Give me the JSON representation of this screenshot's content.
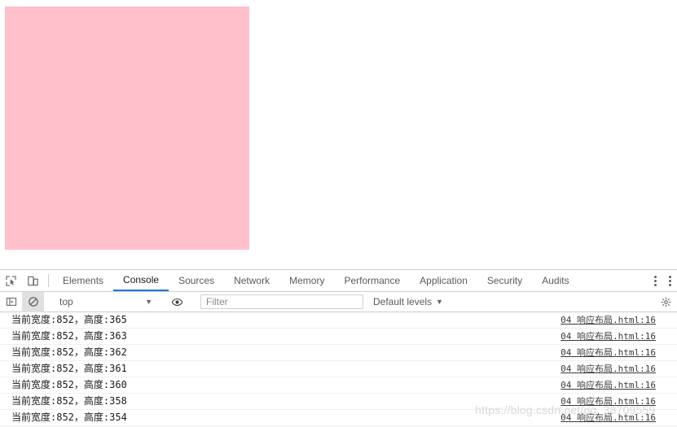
{
  "viewport": {
    "pink_box": {
      "name": "pink-block",
      "color": "#ffc0cb"
    }
  },
  "devtools": {
    "left_tools": [
      {
        "name": "inspect-element-icon",
        "title": "Inspect element"
      },
      {
        "name": "device-toolbar-icon",
        "title": "Toggle device toolbar"
      }
    ],
    "tabs": [
      {
        "label": "Elements",
        "active": false
      },
      {
        "label": "Console",
        "active": true
      },
      {
        "label": "Sources",
        "active": false
      },
      {
        "label": "Network",
        "active": false
      },
      {
        "label": "Memory",
        "active": false
      },
      {
        "label": "Performance",
        "active": false
      },
      {
        "label": "Application",
        "active": false
      },
      {
        "label": "Security",
        "active": false
      },
      {
        "label": "Audits",
        "active": false
      }
    ],
    "tabbar_right": {
      "more_tabs": "⋮",
      "customize_menu": "⋮"
    },
    "console_toolbar": {
      "sidebar_toggle": "console-sidebar-icon",
      "clear_console": "clear-console-icon",
      "context": {
        "value": "top",
        "caret": "▼"
      },
      "eye_icon": "live-expression-icon",
      "filter": {
        "value": "",
        "placeholder": "Filter"
      },
      "levels": {
        "label": "Default levels",
        "caret": "▼"
      },
      "settings_icon": "console-settings-icon"
    },
    "log_entries": [
      {
        "message": "当前宽度:852，高度:365",
        "source": "04 响应布局.html:16"
      },
      {
        "message": "当前宽度:852，高度:363",
        "source": "04 响应布局.html:16"
      },
      {
        "message": "当前宽度:852，高度:362",
        "source": "04 响应布局.html:16"
      },
      {
        "message": "当前宽度:852，高度:361",
        "source": "04 响应布局.html:16"
      },
      {
        "message": "当前宽度:852，高度:360",
        "source": "04 响应布局.html:16"
      },
      {
        "message": "当前宽度:852，高度:358",
        "source": "04 响应布局.html:16"
      },
      {
        "message": "当前宽度:852，高度:354",
        "source": "04 响应布局.html:16"
      }
    ]
  },
  "watermark": {
    "text": "https://blog.csdn.net/qq_38709559"
  }
}
